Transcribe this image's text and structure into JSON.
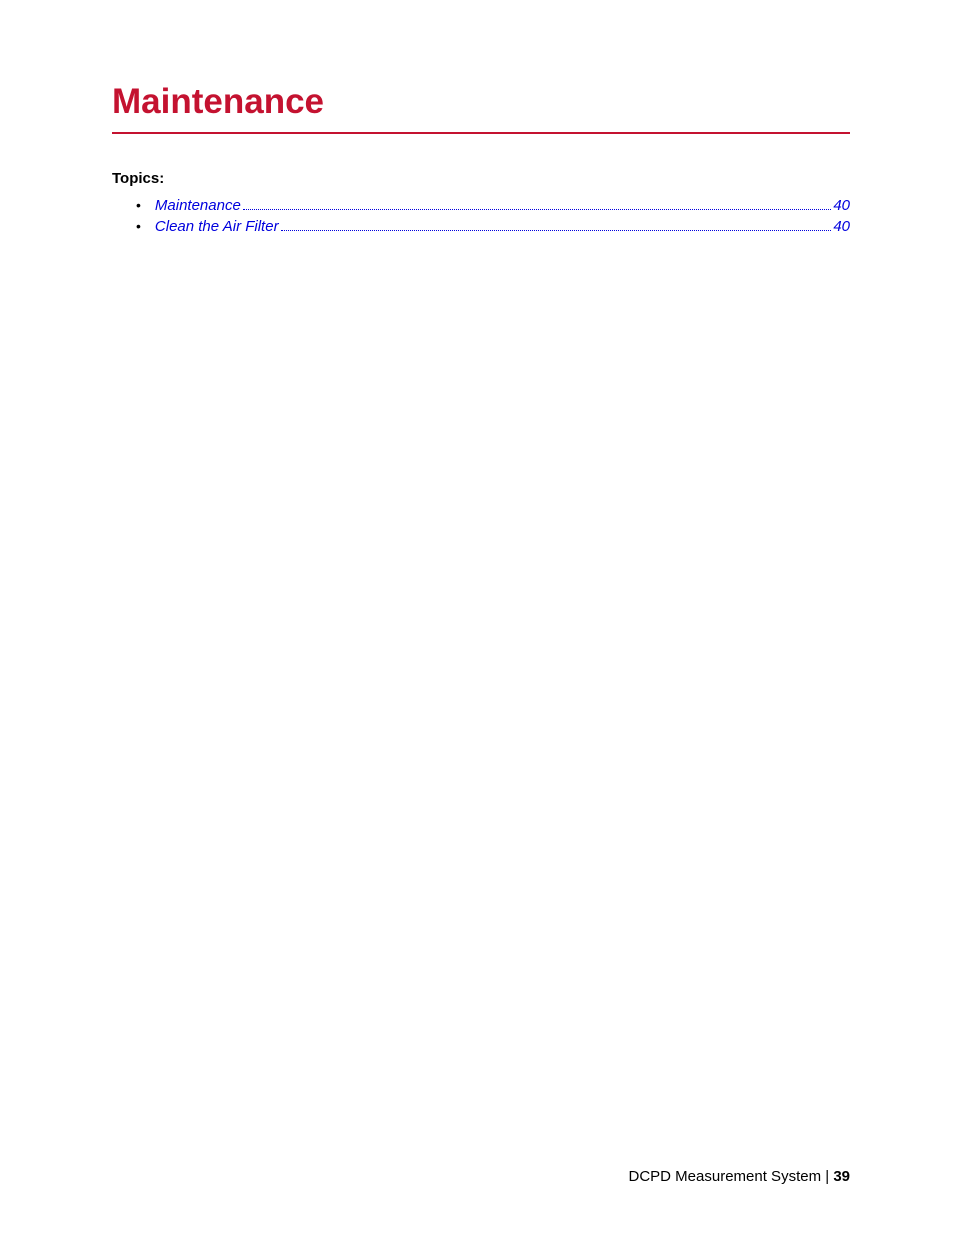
{
  "chapter": {
    "title": "Maintenance"
  },
  "topics": {
    "heading": "Topics:",
    "items": [
      {
        "label": "Maintenance",
        "page": "40"
      },
      {
        "label": "Clean the Air Filter",
        "page": "40"
      }
    ]
  },
  "footer": {
    "doc_title": "DCPD Measurement System",
    "separator": " | ",
    "page_number": "39"
  }
}
